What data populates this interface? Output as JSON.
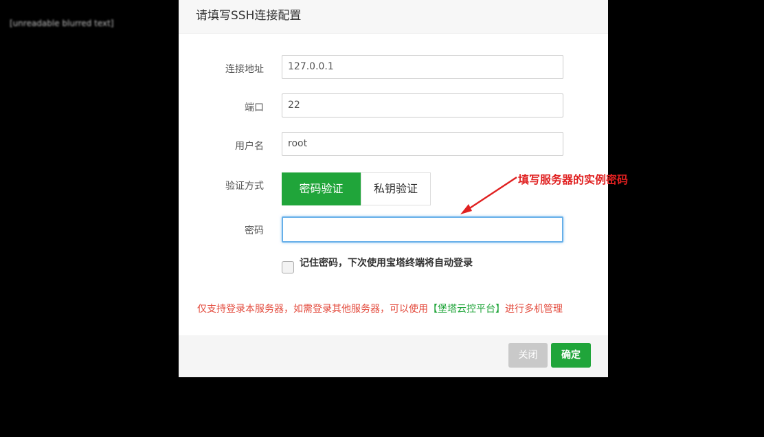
{
  "background": {
    "blurred_text": "[unreadable blurred text]"
  },
  "dialog": {
    "title": "请填写SSH连接配置",
    "fields": {
      "host_label": "连接地址",
      "host_value": "127.0.0.1",
      "port_label": "端口",
      "port_value": "22",
      "user_label": "用户名",
      "user_value": "root",
      "auth_label": "验证方式",
      "password_label": "密码",
      "password_value": ""
    },
    "auth_options": {
      "password": "密码验证",
      "private_key": "私钥验证",
      "selected": "密码验证"
    },
    "remember": {
      "label": "记住密码，下次使用宝塔终端将自动登录",
      "checked": false
    },
    "notice": {
      "prefix": "仅支持登录本服务器，如需登录其他服务器，可以使用",
      "link": "【堡塔云控平台】",
      "suffix": "进行多机管理"
    },
    "footer": {
      "close_label": "关闭",
      "ok_label": "确定"
    }
  },
  "annotation": {
    "text": "填写服务器的实例密码",
    "color": "#e02020"
  },
  "colors": {
    "accent": "#20a53a",
    "notice": "#e34a3c",
    "focus": "#66afe9"
  }
}
